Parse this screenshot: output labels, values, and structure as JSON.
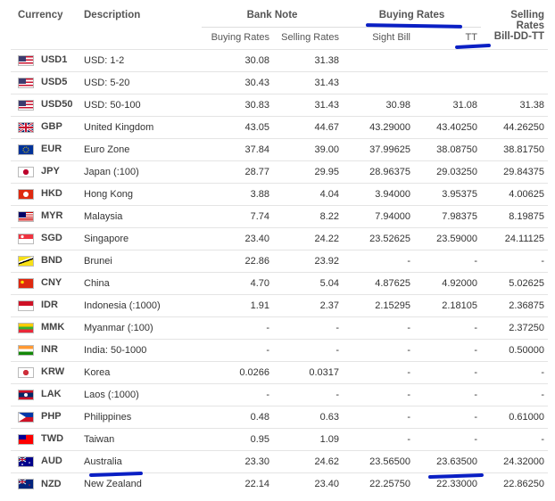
{
  "header": {
    "currency": "Currency",
    "description": "Description",
    "bank_note": "Bank Note",
    "buying_rates": "Buying Rates",
    "selling_rates": "Selling Rates",
    "bill_dd_tt": "Bill-DD-TT",
    "bn_buying": "Buying Rates",
    "bn_selling": "Selling Rates",
    "sight_bill": "Sight Bill",
    "tt": "TT"
  },
  "colors": {
    "annotation": "#0a1fc4",
    "text": "#333333"
  },
  "rows": [
    {
      "code": "USD1",
      "desc": "USD: 1-2",
      "bn_buy": "30.08",
      "bn_sell": "31.38",
      "sight": "",
      "tt": "",
      "sell_tt": "",
      "flag": "us-flag-icon"
    },
    {
      "code": "USD5",
      "desc": "USD: 5-20",
      "bn_buy": "30.43",
      "bn_sell": "31.43",
      "sight": "",
      "tt": "",
      "sell_tt": "",
      "flag": "us-flag-icon"
    },
    {
      "code": "USD50",
      "desc": "USD: 50-100",
      "bn_buy": "30.83",
      "bn_sell": "31.43",
      "sight": "30.98",
      "tt": "31.08",
      "sell_tt": "31.38",
      "flag": "us-flag-icon"
    },
    {
      "code": "GBP",
      "desc": "United Kingdom",
      "bn_buy": "43.05",
      "bn_sell": "44.67",
      "sight": "43.29000",
      "tt": "43.40250",
      "sell_tt": "44.26250",
      "flag": "uk-flag-icon"
    },
    {
      "code": "EUR",
      "desc": "Euro Zone",
      "bn_buy": "37.84",
      "bn_sell": "39.00",
      "sight": "37.99625",
      "tt": "38.08750",
      "sell_tt": "38.81750",
      "flag": "eu-flag-icon"
    },
    {
      "code": "JPY",
      "desc": "Japan (:100)",
      "bn_buy": "28.77",
      "bn_sell": "29.95",
      "sight": "28.96375",
      "tt": "29.03250",
      "sell_tt": "29.84375",
      "flag": "japan-flag-icon"
    },
    {
      "code": "HKD",
      "desc": "Hong Kong",
      "bn_buy": "3.88",
      "bn_sell": "4.04",
      "sight": "3.94000",
      "tt": "3.95375",
      "sell_tt": "4.00625",
      "flag": "hongkong-flag-icon"
    },
    {
      "code": "MYR",
      "desc": "Malaysia",
      "bn_buy": "7.74",
      "bn_sell": "8.22",
      "sight": "7.94000",
      "tt": "7.98375",
      "sell_tt": "8.19875",
      "flag": "malaysia-flag-icon"
    },
    {
      "code": "SGD",
      "desc": "Singapore",
      "bn_buy": "23.40",
      "bn_sell": "24.22",
      "sight": "23.52625",
      "tt": "23.59000",
      "sell_tt": "24.11125",
      "flag": "singapore-flag-icon"
    },
    {
      "code": "BND",
      "desc": "Brunei",
      "bn_buy": "22.86",
      "bn_sell": "23.92",
      "sight": "-",
      "tt": "-",
      "sell_tt": "-",
      "flag": "brunei-flag-icon"
    },
    {
      "code": "CNY",
      "desc": "China",
      "bn_buy": "4.70",
      "bn_sell": "5.04",
      "sight": "4.87625",
      "tt": "4.92000",
      "sell_tt": "5.02625",
      "flag": "china-flag-icon"
    },
    {
      "code": "IDR",
      "desc": "Indonesia (:1000)",
      "bn_buy": "1.91",
      "bn_sell": "2.37",
      "sight": "2.15295",
      "tt": "2.18105",
      "sell_tt": "2.36875",
      "flag": "indonesia-flag-icon"
    },
    {
      "code": "MMK",
      "desc": "Myanmar (:100)",
      "bn_buy": "-",
      "bn_sell": "-",
      "sight": "-",
      "tt": "-",
      "sell_tt": "2.37250",
      "flag": "myanmar-flag-icon"
    },
    {
      "code": "INR",
      "desc": "India: 50-1000",
      "bn_buy": "-",
      "bn_sell": "-",
      "sight": "-",
      "tt": "-",
      "sell_tt": "0.50000",
      "flag": "india-flag-icon"
    },
    {
      "code": "KRW",
      "desc": "Korea",
      "bn_buy": "0.0266",
      "bn_sell": "0.0317",
      "sight": "-",
      "tt": "-",
      "sell_tt": "-",
      "flag": "korea-flag-icon"
    },
    {
      "code": "LAK",
      "desc": "Laos (:1000)",
      "bn_buy": "-",
      "bn_sell": "-",
      "sight": "-",
      "tt": "-",
      "sell_tt": "-",
      "flag": "laos-flag-icon"
    },
    {
      "code": "PHP",
      "desc": "Philippines",
      "bn_buy": "0.48",
      "bn_sell": "0.63",
      "sight": "-",
      "tt": "-",
      "sell_tt": "0.61000",
      "flag": "philippines-flag-icon"
    },
    {
      "code": "TWD",
      "desc": "Taiwan",
      "bn_buy": "0.95",
      "bn_sell": "1.09",
      "sight": "-",
      "tt": "-",
      "sell_tt": "-",
      "flag": "taiwan-flag-icon"
    },
    {
      "code": "AUD",
      "desc": "Australia",
      "bn_buy": "23.30",
      "bn_sell": "24.62",
      "sight": "23.56500",
      "tt": "23.63500",
      "sell_tt": "24.32000",
      "flag": "australia-flag-icon"
    },
    {
      "code": "NZD",
      "desc": "New Zealand",
      "bn_buy": "22.14",
      "bn_sell": "23.40",
      "sight": "22.25750",
      "tt": "22.33000",
      "sell_tt": "22.86250",
      "flag": "newzealand-flag-icon"
    }
  ]
}
